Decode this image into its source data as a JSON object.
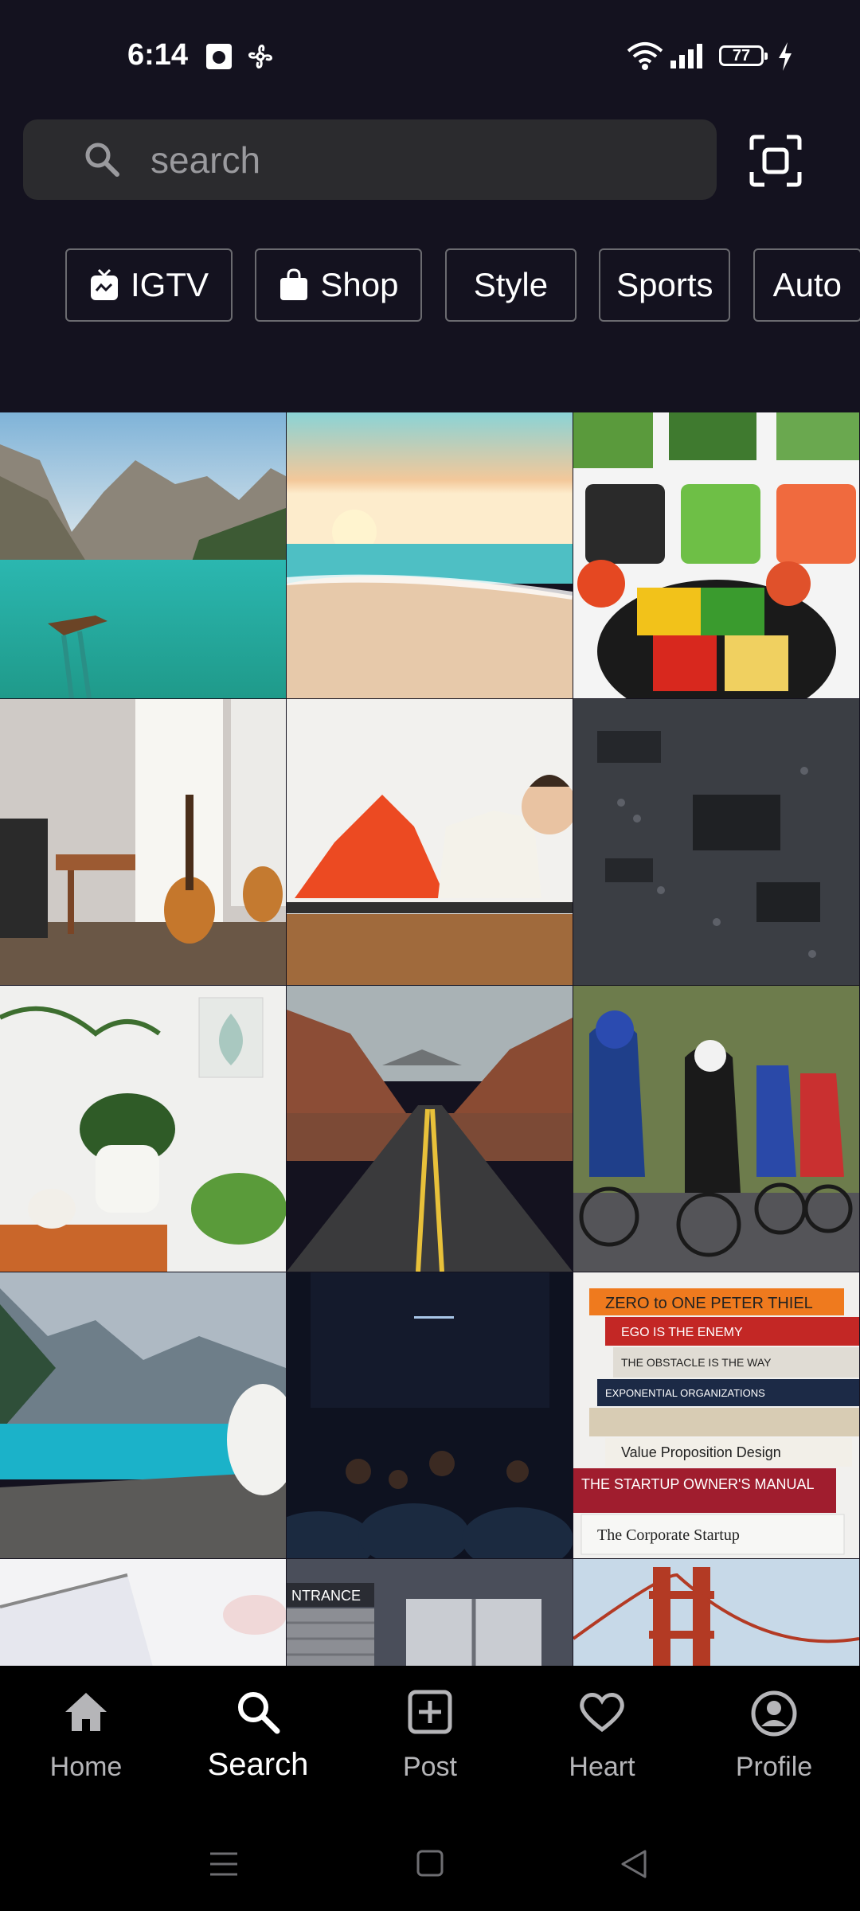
{
  "status": {
    "time": "6:14",
    "battery": "77"
  },
  "search": {
    "placeholder": "search"
  },
  "chips": [
    {
      "label": "IGTV",
      "icon": "tv-icon"
    },
    {
      "label": "Shop",
      "icon": "shopping-bag-icon"
    },
    {
      "label": "Style",
      "icon": ""
    },
    {
      "label": "Sports",
      "icon": ""
    },
    {
      "label": "Auto",
      "icon": ""
    }
  ],
  "grid": {
    "tiles": [
      {
        "subject": "mountain lake with boat"
      },
      {
        "subject": "beach at sunset"
      },
      {
        "subject": "vegetable platter"
      },
      {
        "subject": "guitars in room"
      },
      {
        "subject": "woman doing crunches"
      },
      {
        "subject": "circuit board"
      },
      {
        "subject": "house plants"
      },
      {
        "subject": "desert road"
      },
      {
        "subject": "cyclists racing"
      },
      {
        "subject": "lake with dog"
      },
      {
        "subject": "cinema audience"
      },
      {
        "subject": "stack of books"
      },
      {
        "subject": "white fabric"
      },
      {
        "subject": "building entrance"
      },
      {
        "subject": "golden gate bridge"
      }
    ],
    "book_titles": [
      "ZERO to ONE  PETER THIEL",
      "EGO IS THE ENEMY",
      "THE OBSTACLE IS THE WAY",
      "EXPONENTIAL ORGANIZATIONS",
      "Value Proposition Design",
      "THE STARTUP OWNER'S MANUAL",
      "The Corporate Startup"
    ],
    "entrance_sign": "NTRANCE"
  },
  "nav": [
    {
      "label": "Home",
      "icon": "home-icon"
    },
    {
      "label": "Search",
      "icon": "search-icon"
    },
    {
      "label": "Post",
      "icon": "add-box-icon"
    },
    {
      "label": "Heart",
      "icon": "heart-icon"
    },
    {
      "label": "Profile",
      "icon": "account-circle-icon"
    }
  ],
  "colors": {
    "background": "#14121f",
    "nav_bg": "#000000",
    "chip_border": "#6b6b70",
    "search_bg": "#2b2b2e"
  }
}
